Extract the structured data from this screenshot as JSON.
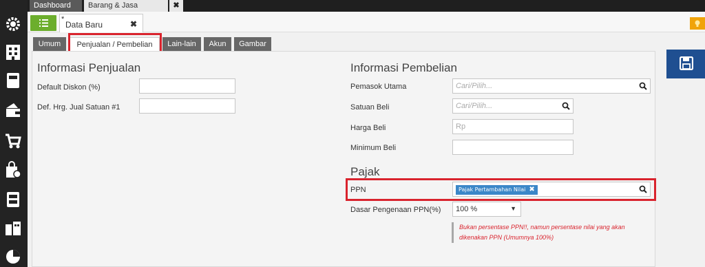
{
  "top_tabs": [
    {
      "label": "Dashboard"
    },
    {
      "label": "Barang & Jasa"
    },
    {
      "label": "✖"
    }
  ],
  "doc_tab": {
    "modified_mark": "*",
    "label": "Data Baru",
    "close": "✖"
  },
  "sub_tabs": [
    {
      "label": "Umum"
    },
    {
      "label": "Penjualan / Pembelian"
    },
    {
      "label": "Lain-lain"
    },
    {
      "label": "Akun"
    },
    {
      "label": "Gambar"
    }
  ],
  "penjualan": {
    "title": "Informasi Penjualan",
    "default_diskon_label": "Default Diskon (%)",
    "def_harga_label": "Def. Hrg. Jual Satuan #1"
  },
  "pembelian": {
    "title": "Informasi Pembelian",
    "pemasok_label": "Pemasok Utama",
    "pemasok_placeholder": "Cari/Pilih...",
    "satuan_label": "Satuan Beli",
    "satuan_placeholder": "Cari/Pilih...",
    "harga_label": "Harga Beli",
    "harga_placeholder": "Rp",
    "minimum_label": "Minimum Beli"
  },
  "pajak": {
    "title": "Pajak",
    "ppn_label": "PPN",
    "ppn_tag": "Pajak Pertambahan Nilai",
    "ppn_tag_remove": "✖",
    "dasar_label": "Dasar Pengenaan PPN(%)",
    "dasar_value": "100 %",
    "dasar_arrow": "▼",
    "note": "Bukan persentase PPN!!, namun persentase nilai yang akan dikenakan PPN (Umumnya 100%)"
  },
  "colors": {
    "accent_green": "#6cae2d",
    "highlight_red": "#d9232d",
    "save_blue": "#1f4f91",
    "tag_blue": "#3b87c8"
  },
  "icons": [
    "gear-icon",
    "building-icon",
    "ledger-icon",
    "wallet-icon",
    "cart-icon",
    "bag-add-icon",
    "cabinet-icon",
    "city-icon",
    "pie-chart-icon",
    "list-icon",
    "bulb-icon",
    "search-icon",
    "floppy-icon"
  ]
}
